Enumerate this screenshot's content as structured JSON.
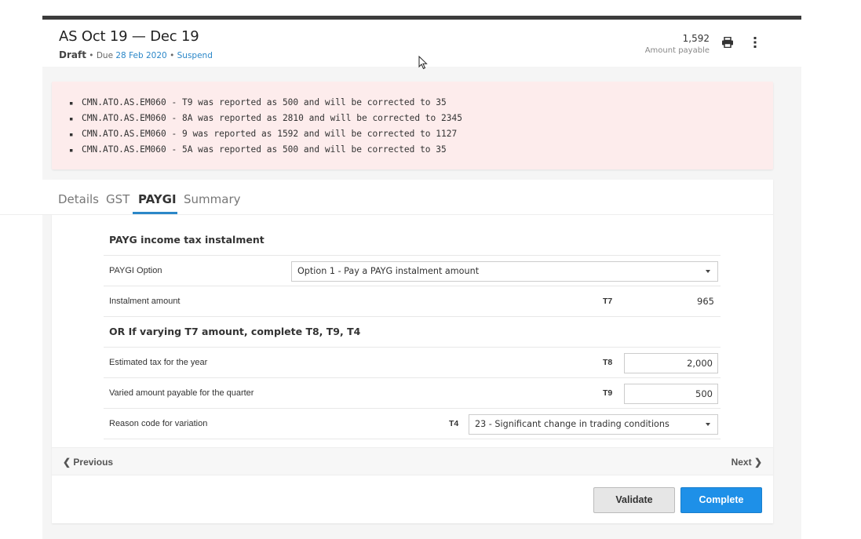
{
  "header": {
    "title": "AS Oct 19 — Dec 19",
    "status": "Draft",
    "due_text": "Due",
    "due_date": "28 Feb 2020",
    "separator": "•",
    "suspend_label": "Suspend",
    "amount_value": "1,592",
    "amount_label": "Amount payable",
    "print_icon": "print-icon",
    "more_icon": "more-vertical-icon"
  },
  "errors": [
    "CMN.ATO.AS.EM060 - T9 was reported as 500 and will be corrected to 35",
    "CMN.ATO.AS.EM060 - 8A was reported as 2810 and will be corrected to 2345",
    "CMN.ATO.AS.EM060 - 9 was reported as 1592 and will be corrected to 1127",
    "CMN.ATO.AS.EM060 - 5A was reported as 500 and will be corrected to 35"
  ],
  "tabs": [
    {
      "label": "Details"
    },
    {
      "label": "GST"
    },
    {
      "label": "PAYGI",
      "active": true
    },
    {
      "label": "Summary"
    }
  ],
  "form": {
    "section1_title": "PAYG income tax instalment",
    "paygi_option_label": "PAYGI Option",
    "paygi_option_value": "Option 1 - Pay a PAYG instalment amount",
    "instalment_label": "Instalment amount",
    "instalment_code": "T7",
    "instalment_value": "965",
    "section2_title": "OR If varying T7 amount, complete T8, T9, T4",
    "estimated_label": "Estimated tax for the year",
    "estimated_code": "T8",
    "estimated_value": "2,000",
    "varied_label": "Varied amount payable for the quarter",
    "varied_code": "T9",
    "varied_value": "500",
    "reason_label": "Reason code for variation",
    "reason_code": "T4",
    "reason_value": "23 - Significant change in trading conditions"
  },
  "nav": {
    "previous_label": "Previous",
    "next_label": "Next"
  },
  "actions": {
    "validate_label": "Validate",
    "complete_label": "Complete"
  },
  "colors": {
    "accent": "#2b87c8",
    "complete_button": "#1e90e8",
    "error_background": "#fdecec"
  }
}
